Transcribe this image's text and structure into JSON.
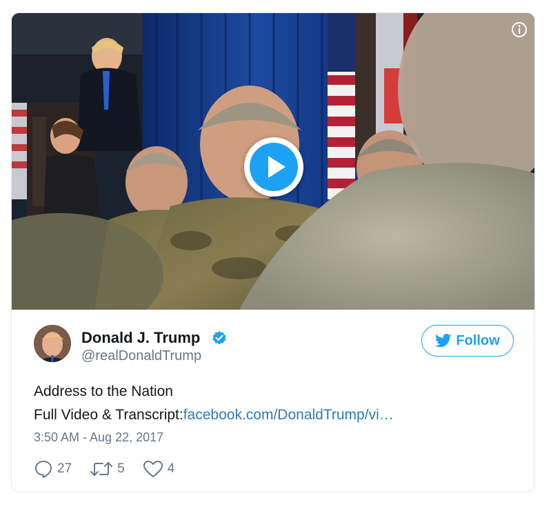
{
  "tweet": {
    "author_name": "Donald J. Trump",
    "author_handle": "@realDonaldTrump",
    "follow_label": "Follow",
    "text_line1": "Address to the Nation",
    "text_line2_prefix": "Full Video & Transcript:",
    "link_text": "facebook.com/DonaldTrump/vi…",
    "timestamp": "3:50 AM - Aug 22, 2017",
    "reply_count": "27",
    "retweet_count": "5",
    "like_count": "4"
  },
  "icons": {
    "info": "info-icon",
    "play": "play-icon",
    "verified": "verified-badge-icon",
    "bird": "twitter-bird-icon",
    "reply": "reply-icon",
    "retweet": "retweet-icon",
    "like": "heart-icon"
  },
  "colors": {
    "accent": "#1da1f2",
    "link": "#2b7bb9",
    "text": "#14171a",
    "muted": "#657786",
    "border": "#e1e8ed"
  }
}
